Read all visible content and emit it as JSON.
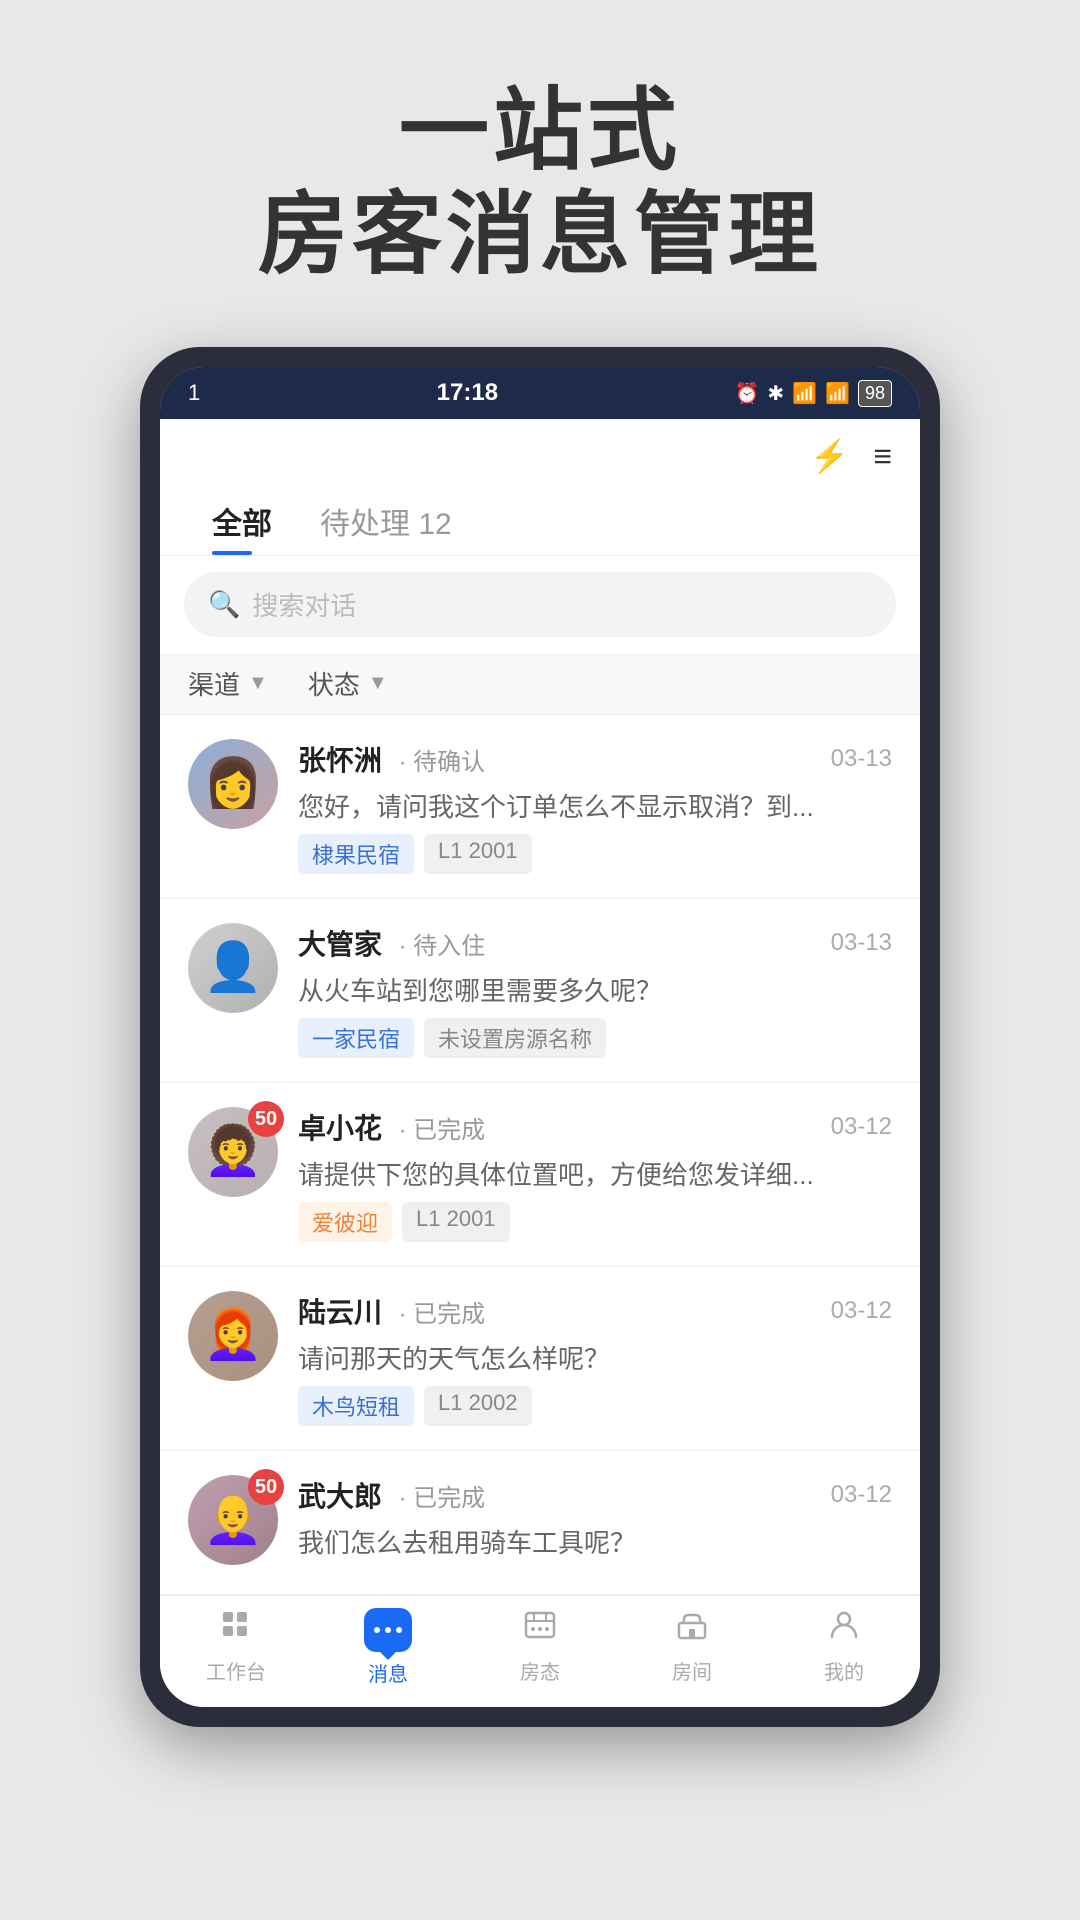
{
  "page": {
    "headline_line1": "一站式",
    "headline_line2": "房客消息管理"
  },
  "status_bar": {
    "left": "1",
    "time": "17:18",
    "battery": "98"
  },
  "header": {
    "lightning_icon": "⚡",
    "menu_icon": "≡"
  },
  "tabs": [
    {
      "label": "全部",
      "active": true
    },
    {
      "label": "待处理 12",
      "active": false
    }
  ],
  "search": {
    "placeholder": "搜索对话"
  },
  "filters": [
    {
      "label": "渠道",
      "id": "channel-filter"
    },
    {
      "label": "状态",
      "id": "status-filter"
    }
  ],
  "messages": [
    {
      "id": 1,
      "name": "张怀洲",
      "status": "· 待确认",
      "date": "03-13",
      "preview": "您好，请问我这个订单怎么不显示取消？到...",
      "tags": [
        "棣果民宿",
        "L1 2001"
      ],
      "tag_styles": [
        "blue",
        "gray"
      ],
      "avatar_class": "avatar-1",
      "unread": null
    },
    {
      "id": 2,
      "name": "大管家",
      "status": "· 待入住",
      "date": "03-13",
      "preview": "从火车站到您哪里需要多久呢？",
      "tags": [
        "一家民宿",
        "未设置房源名称"
      ],
      "tag_styles": [
        "blue",
        "gray"
      ],
      "avatar_class": "avatar-2",
      "unread": null
    },
    {
      "id": 3,
      "name": "卓小花",
      "status": "· 已完成",
      "date": "03-12",
      "preview": "请提供下您的具体位置吧，方便给您发详细...",
      "tags": [
        "爱彼迎",
        "L1 2001"
      ],
      "tag_styles": [
        "orange",
        "gray"
      ],
      "avatar_class": "avatar-3",
      "unread": "50"
    },
    {
      "id": 4,
      "name": "陆云川",
      "status": "· 已完成",
      "date": "03-12",
      "preview": "请问那天的天气怎么样呢？",
      "tags": [
        "木鸟短租",
        "L1 2002"
      ],
      "tag_styles": [
        "blue",
        "gray"
      ],
      "avatar_class": "avatar-4",
      "unread": null
    },
    {
      "id": 5,
      "name": "武大郎",
      "status": "· 已完成",
      "date": "03-12",
      "preview": "我们怎么去租用骑车工具呢？",
      "tags": [],
      "tag_styles": [],
      "avatar_class": "avatar-5",
      "unread": "50"
    }
  ],
  "bottom_nav": [
    {
      "label": "工作台",
      "icon": "workbench",
      "active": false
    },
    {
      "label": "消息",
      "icon": "messages",
      "active": true
    },
    {
      "label": "房态",
      "icon": "calendar",
      "active": false
    },
    {
      "label": "房间",
      "icon": "room",
      "active": false
    },
    {
      "label": "我的",
      "icon": "profile",
      "active": false
    }
  ]
}
